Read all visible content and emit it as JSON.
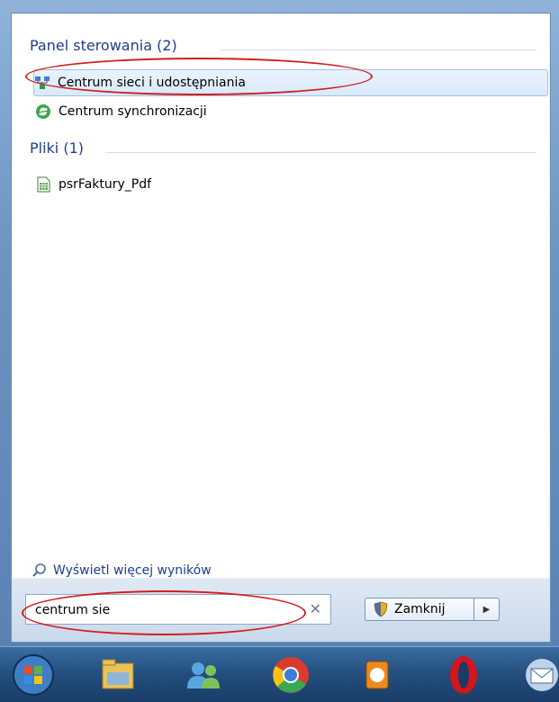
{
  "results": {
    "groups": [
      {
        "header": "Panel sterowania (2)",
        "items": [
          {
            "label": "Centrum sieci i udostępniania",
            "icon": "network-sharing-center-icon"
          },
          {
            "label": "Centrum synchronizacji",
            "icon": "sync-center-icon"
          }
        ]
      },
      {
        "header": "Pliki (1)",
        "items": [
          {
            "label": "psrFaktury_Pdf",
            "icon": "spreadsheet-file-icon"
          }
        ]
      }
    ],
    "see_more": "Wyświetl więcej wyników"
  },
  "search": {
    "value": "centrum sie",
    "clear_icon": "close-icon"
  },
  "shutdown": {
    "label": "Zamknij",
    "icon": "shield-icon",
    "arrow_icon": "chevron-right-icon"
  },
  "taskbar": {
    "items": [
      "start-orb-icon",
      "file-explorer-icon",
      "messenger-icon",
      "chrome-icon",
      "media-player-icon",
      "opera-icon",
      "thunderbird-icon"
    ]
  },
  "colors": {
    "accent_text": "#1e3f8c",
    "highlight": "#d9eafb",
    "annotation": "#d21f1f"
  }
}
